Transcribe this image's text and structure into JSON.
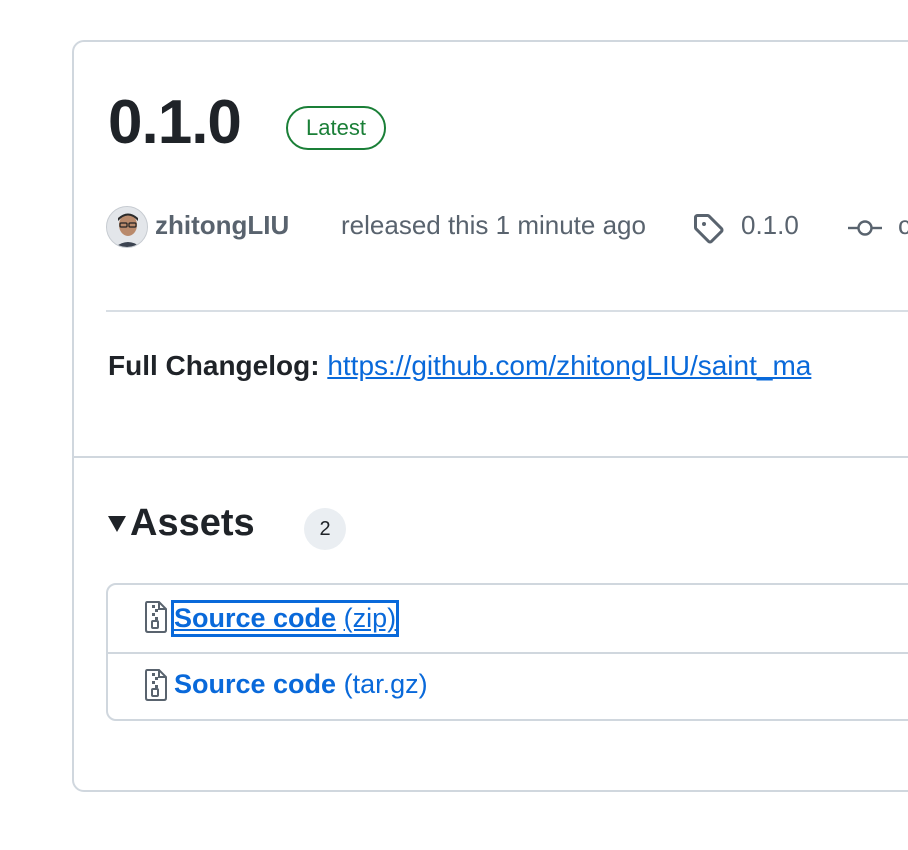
{
  "release": {
    "version": "0.1.0",
    "badge": "Latest",
    "author": "zhitongLIU",
    "released_text": "released this 1 minute ago",
    "tag": "0.1.0",
    "commit": "c"
  },
  "changelog": {
    "label": "Full Changelog:",
    "link_text": "https://github.com/zhitongLIU/saint_ma"
  },
  "assets": {
    "title": "Assets",
    "count": "2",
    "items": [
      {
        "name": "Source code",
        "ext": "(zip)"
      },
      {
        "name": "Source code",
        "ext": "(tar.gz)"
      }
    ]
  },
  "colors": {
    "link": "#0969da",
    "latest_badge": "#1a7f37",
    "muted_text": "#59636e",
    "border": "#d0d7de"
  },
  "icons": [
    "avatar",
    "tag-icon",
    "git-commit-icon",
    "file-zip-icon",
    "triangle-down-icon"
  ]
}
